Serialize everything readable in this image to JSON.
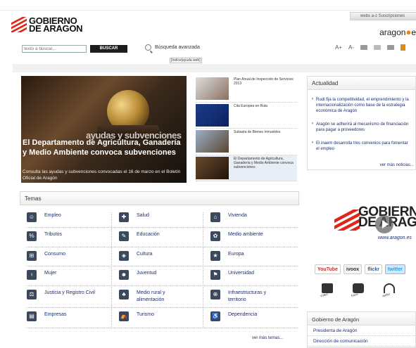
{
  "header": {
    "logo_line1": "GOBIERNO",
    "logo_line2": "DE ARAGON",
    "tab_label": "webs a-z  Suscripciones",
    "aragon_es": "aragon",
    "aragon_es_suffix": "e"
  },
  "search": {
    "placeholder": "texto a buscar...",
    "button": "BUSCAR",
    "advanced": "Búsqueda avanzada",
    "accessibility": "[índice|ayuda web]"
  },
  "tools": {
    "a_plus": "A+",
    "a_minus": "A-"
  },
  "feature": {
    "overlay_word": "ayudas y subvenciones",
    "title": "El Departamento de Agricultura, Ganadería y Medio Ambiente convoca subvenciones",
    "subtitle": "Consulta las ayudas y subvenciones convocadas el 16 de marzo en el Boletín Oficial de Aragón"
  },
  "thumbs": [
    {
      "text": "Plan Anual de Inspección de Servicios 2013"
    },
    {
      "text": "Cita Europea en Ruta"
    },
    {
      "text": "Subasta de Bienes Inmuebles"
    },
    {
      "text": "El Departamento de Agricultura, Ganadería y Medio Ambiente convoca subvenciones"
    }
  ],
  "temas": {
    "title": "Temas",
    "items": [
      {
        "label": "Empleo",
        "icon": "people-icon"
      },
      {
        "label": "Salud",
        "icon": "health-icon"
      },
      {
        "label": "Vivienda",
        "icon": "house-icon"
      },
      {
        "label": "Tributos",
        "icon": "percent-icon"
      },
      {
        "label": "Educación",
        "icon": "education-icon"
      },
      {
        "label": "Medio ambiente",
        "icon": "environment-icon"
      },
      {
        "label": "Consumo",
        "icon": "cart-icon"
      },
      {
        "label": "Cultura",
        "icon": "culture-icon"
      },
      {
        "label": "Europa",
        "icon": "europe-icon"
      },
      {
        "label": "Mujer",
        "icon": "woman-icon"
      },
      {
        "label": "Juventud",
        "icon": "youth-icon"
      },
      {
        "label": "Universidad",
        "icon": "university-icon"
      },
      {
        "label": "Justicia y Registro Civil",
        "icon": "justice-icon"
      },
      {
        "label": "Medio rural y alimentación",
        "icon": "rural-icon"
      },
      {
        "label": "Infraestructuras y territorio",
        "icon": "infrastructure-icon"
      },
      {
        "label": "Empresas",
        "icon": "business-icon"
      },
      {
        "label": "Turismo",
        "icon": "tourism-icon"
      },
      {
        "label": "Dependencia",
        "icon": "dependency-icon"
      }
    ],
    "more": "ver más temas..."
  },
  "actualidad": {
    "title": "Actualidad",
    "news": [
      "Rudi fija la competitividad, el emprendimiento y la internacionalización como base de la estrategia económica de Aragón",
      "Aragón se adherirá al mecanismo de financiación para pagar a proveedores",
      "El inaem desarrolla tres convenios para fomentar el empleo"
    ],
    "more": "ver más noticias..."
  },
  "video": {
    "line1": "GOBIERNO",
    "line2": "DE ARAG",
    "url": "www.aragon.es"
  },
  "social": [
    "YouTube",
    "ivoox",
    "flickr",
    "twitter"
  ],
  "media": [
    "vídeo",
    "fotos",
    "audio"
  ],
  "gobierno": {
    "title": "Gobierno de Aragón",
    "links": [
      "Presidenta de Aragón",
      "Dirección de comunicación"
    ]
  },
  "colors": {
    "accent": "#e0261a",
    "link": "#1b2f6e"
  }
}
